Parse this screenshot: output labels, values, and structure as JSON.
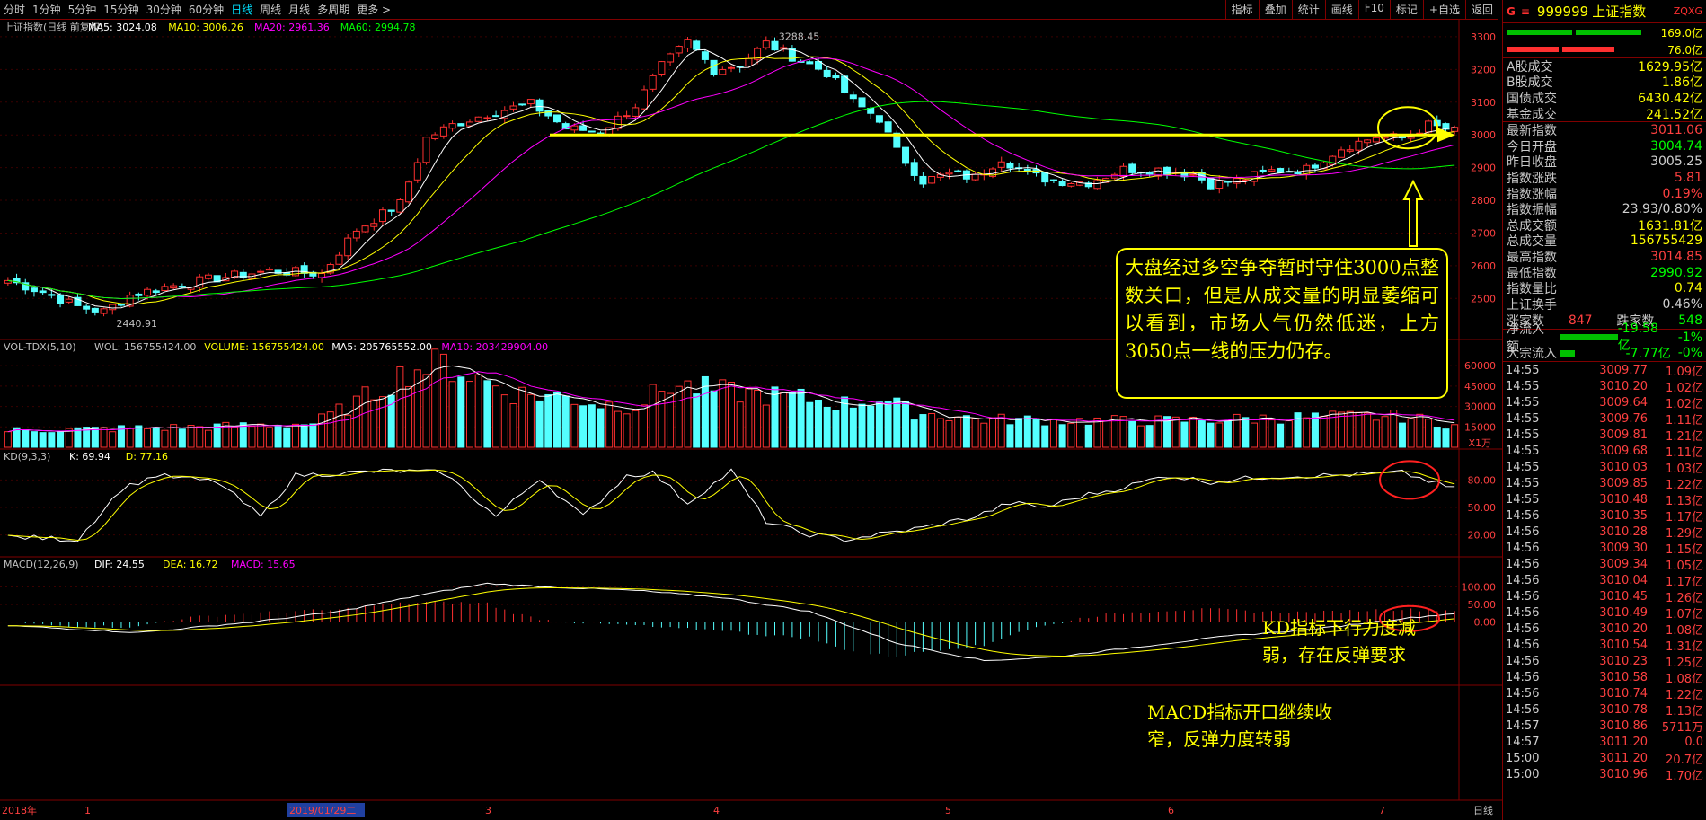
{
  "topbar": {
    "tabs": [
      "分时",
      "1分钟",
      "5分钟",
      "15分钟",
      "30分钟",
      "60分钟",
      "日线",
      "周线",
      "月线",
      "多周期",
      "更多 >"
    ],
    "active": "日线",
    "tools": [
      "指标",
      "叠加",
      "统计",
      "画线",
      "F10",
      "标记",
      "+自选",
      "返回"
    ]
  },
  "panels": {
    "price": {
      "title": "上证指数(日线 前复权)",
      "ma": [
        {
          "label": "MA5: 3024.08",
          "color": "#ffffff"
        },
        {
          "label": "MA10: 3006.26",
          "color": "#ffff00"
        },
        {
          "label": "MA20: 2961.36",
          "color": "#ff00ff"
        },
        {
          "label": "MA60: 2994.78",
          "color": "#00ff00"
        }
      ],
      "high_label": "3288.45",
      "low_label": "2440.91"
    },
    "volume": {
      "title": "VOL-TDX(5,10)",
      "items": [
        {
          "label": "WOL: 156755424.00",
          "color": "#c0c0c0"
        },
        {
          "label": "VOLUME: 156755424.00",
          "color": "#ffff00"
        },
        {
          "label": "MA5: 205765552.00",
          "color": "#ffffff"
        },
        {
          "label": "MA10: 203429904.00",
          "color": "#ff00ff"
        }
      ],
      "unit": "X1万"
    },
    "kd": {
      "title": "KD(9,3,3)",
      "items": [
        {
          "label": "K: 69.94",
          "color": "#ffffff"
        },
        {
          "label": "D: 77.16",
          "color": "#ffff00"
        }
      ]
    },
    "macd": {
      "title": "MACD(12,26,9)",
      "items": [
        {
          "label": "DIF: 24.55",
          "color": "#ffffff"
        },
        {
          "label": "DEA: 16.72",
          "color": "#ffff00"
        },
        {
          "label": "MACD: 15.65",
          "color": "#ff00ff"
        }
      ]
    }
  },
  "annotations": {
    "main": "大盘经过多空争夺暂时守住3000点整数关口，但是从成交量的明显萎缩可以看到，市场人气仍然低迷，上方3050点一线的压力仍存。",
    "kd": "KD指标下行力度减弱，存在反弹要求",
    "macd": "MACD指标开口继续收窄，反弹力度转弱"
  },
  "xaxis": {
    "labels": [
      "2018年",
      "1",
      "2019/01/29二",
      "3",
      "4",
      "5",
      "6",
      "7"
    ],
    "right": "日线"
  },
  "sidebar": {
    "code": "999999",
    "name": "上证指数",
    "tag": "ZQXG",
    "bar_vals": [
      "169.0亿",
      "76.0亿"
    ],
    "trade": [
      [
        "A股成交",
        "1629.95亿"
      ],
      [
        "B股成交",
        "1.86亿"
      ],
      [
        "国债成交",
        "6430.42亿"
      ],
      [
        "基金成交",
        "241.52亿"
      ]
    ],
    "quote": [
      [
        "最新指数",
        "3011.06",
        "#ff4040"
      ],
      [
        "今日开盘",
        "3004.74",
        "#00ff00"
      ],
      [
        "昨日收盘",
        "3005.25",
        "#d0d0d0"
      ],
      [
        "指数涨跌",
        "5.81",
        "#ff4040"
      ],
      [
        "指数涨幅",
        "0.19%",
        "#ff4040"
      ],
      [
        "指数振幅",
        "23.93/0.80%",
        "#d0d0d0"
      ],
      [
        "总成交额",
        "1631.81亿",
        "#ffff00"
      ],
      [
        "总成交量",
        "156755429",
        "#ffff00"
      ],
      [
        "最高指数",
        "3014.85",
        "#ff4040"
      ],
      [
        "最低指数",
        "2990.92",
        "#00ff00"
      ],
      [
        "指数量比",
        "0.74",
        "#ffff00"
      ],
      [
        "上证换手",
        "0.46%",
        "#d0d0d0"
      ]
    ],
    "updown": {
      "up_label": "涨家数",
      "up": "847",
      "down_label": "跌家数",
      "down": "548"
    },
    "flows": [
      [
        "净流入额",
        "-19.58亿",
        "-1%"
      ],
      [
        "大宗流入",
        "-7.77亿",
        "-0%"
      ]
    ],
    "ticks": [
      [
        "14:55",
        "3009.77",
        "1.09亿"
      ],
      [
        "14:55",
        "3010.20",
        "1.02亿"
      ],
      [
        "14:55",
        "3009.64",
        "1.02亿"
      ],
      [
        "14:55",
        "3009.76",
        "1.11亿"
      ],
      [
        "14:55",
        "3009.81",
        "1.21亿"
      ],
      [
        "14:55",
        "3009.68",
        "1.11亿"
      ],
      [
        "14:55",
        "3010.03",
        "1.03亿"
      ],
      [
        "14:55",
        "3009.85",
        "1.22亿"
      ],
      [
        "14:55",
        "3010.48",
        "1.13亿"
      ],
      [
        "14:56",
        "3010.35",
        "1.17亿"
      ],
      [
        "14:56",
        "3010.28",
        "1.29亿"
      ],
      [
        "14:56",
        "3009.30",
        "1.15亿"
      ],
      [
        "14:56",
        "3009.34",
        "1.05亿"
      ],
      [
        "14:56",
        "3010.04",
        "1.17亿"
      ],
      [
        "14:56",
        "3010.45",
        "1.26亿"
      ],
      [
        "14:56",
        "3010.49",
        "1.07亿"
      ],
      [
        "14:56",
        "3010.20",
        "1.08亿"
      ],
      [
        "14:56",
        "3010.54",
        "1.31亿"
      ],
      [
        "14:56",
        "3010.23",
        "1.25亿"
      ],
      [
        "14:56",
        "3010.58",
        "1.08亿"
      ],
      [
        "14:56",
        "3010.74",
        "1.22亿"
      ],
      [
        "14:56",
        "3010.78",
        "1.13亿"
      ],
      [
        "14:57",
        "3010.86",
        "5711万"
      ],
      [
        "14:57",
        "3011.20",
        "0.0"
      ],
      [
        "15:00",
        "3011.20",
        "20.7亿"
      ],
      [
        "15:00",
        "3010.96",
        "1.70亿"
      ]
    ]
  },
  "chart_data": [
    {
      "type": "candlestick",
      "name": "上证指数",
      "ylim": [
        2380,
        3330
      ],
      "yticks": [
        2500,
        2600,
        2700,
        2800,
        2900,
        3000,
        3100,
        3200,
        3300
      ],
      "trend_line": 3000,
      "waypoints": [
        [
          0,
          2555
        ],
        [
          4,
          2520
        ],
        [
          8,
          2475
        ],
        [
          11,
          2460
        ],
        [
          14,
          2510
        ],
        [
          18,
          2535
        ],
        [
          24,
          2562
        ],
        [
          30,
          2585
        ],
        [
          36,
          2575
        ],
        [
          40,
          2710
        ],
        [
          45,
          2790
        ],
        [
          48,
          2990
        ],
        [
          51,
          3030
        ],
        [
          55,
          3065
        ],
        [
          60,
          3095
        ],
        [
          62,
          3060
        ],
        [
          64,
          3020
        ],
        [
          68,
          3010
        ],
        [
          72,
          3090
        ],
        [
          75,
          3210
        ],
        [
          78,
          3285
        ],
        [
          81,
          3200
        ],
        [
          84,
          3215
        ],
        [
          87,
          3280
        ],
        [
          90,
          3240
        ],
        [
          94,
          3190
        ],
        [
          97,
          3100
        ],
        [
          100,
          3050
        ],
        [
          102,
          2950
        ],
        [
          105,
          2860
        ],
        [
          108,
          2880
        ],
        [
          111,
          2870
        ],
        [
          114,
          2930
        ],
        [
          117,
          2880
        ],
        [
          120,
          2860
        ],
        [
          124,
          2855
        ],
        [
          128,
          2895
        ],
        [
          132,
          2895
        ],
        [
          136,
          2880
        ],
        [
          138,
          2850
        ],
        [
          141,
          2860
        ],
        [
          145,
          2890
        ],
        [
          149,
          2895
        ],
        [
          153,
          2960
        ],
        [
          157,
          2995
        ],
        [
          160,
          2990
        ],
        [
          163,
          3030
        ],
        [
          166,
          3011
        ]
      ]
    },
    {
      "type": "bar",
      "name": "VOLUME",
      "unit": "X1万",
      "ylim": [
        0,
        70000
      ],
      "yticks": [
        15000,
        30000,
        45000,
        60000
      ],
      "waypoints": [
        [
          0,
          12000
        ],
        [
          10,
          13000
        ],
        [
          25,
          15000
        ],
        [
          35,
          17000
        ],
        [
          40,
          32000
        ],
        [
          46,
          55000
        ],
        [
          50,
          60000
        ],
        [
          58,
          39000
        ],
        [
          64,
          36000
        ],
        [
          68,
          31000
        ],
        [
          72,
          30000
        ],
        [
          76,
          45000
        ],
        [
          82,
          40000
        ],
        [
          90,
          36000
        ],
        [
          96,
          31000
        ],
        [
          100,
          35000
        ],
        [
          104,
          25000
        ],
        [
          112,
          20000
        ],
        [
          125,
          19000
        ],
        [
          135,
          19000
        ],
        [
          145,
          21000
        ],
        [
          155,
          22000
        ],
        [
          160,
          22000
        ],
        [
          166,
          15700
        ]
      ]
    },
    {
      "type": "line",
      "name": "KD",
      "ylim": [
        0,
        100
      ],
      "yticks": [
        20,
        50,
        80
      ],
      "waypoints": [
        [
          0,
          18
        ],
        [
          8,
          15
        ],
        [
          13,
          70
        ],
        [
          17,
          85
        ],
        [
          24,
          78
        ],
        [
          29,
          40
        ],
        [
          33,
          85
        ],
        [
          44,
          90
        ],
        [
          50,
          88
        ],
        [
          56,
          40
        ],
        [
          61,
          82
        ],
        [
          66,
          40
        ],
        [
          71,
          85
        ],
        [
          74,
          88
        ],
        [
          78,
          55
        ],
        [
          83,
          90
        ],
        [
          87,
          35
        ],
        [
          91,
          22
        ],
        [
          96,
          15
        ],
        [
          101,
          22
        ],
        [
          105,
          28
        ],
        [
          111,
          40
        ],
        [
          115,
          55
        ],
        [
          119,
          50
        ],
        [
          123,
          62
        ],
        [
          128,
          72
        ],
        [
          133,
          85
        ],
        [
          138,
          78
        ],
        [
          145,
          84
        ],
        [
          152,
          85
        ],
        [
          160,
          88
        ],
        [
          166,
          70
        ]
      ]
    },
    {
      "type": "line",
      "name": "MACD",
      "ylim": [
        -170,
        150
      ],
      "yticks": [
        0,
        50,
        100
      ],
      "waypoints": [
        [
          0,
          -10
        ],
        [
          15,
          -30
        ],
        [
          28,
          0
        ],
        [
          38,
          30
        ],
        [
          48,
          80
        ],
        [
          55,
          110
        ],
        [
          62,
          100
        ],
        [
          72,
          90
        ],
        [
          82,
          70
        ],
        [
          92,
          30
        ],
        [
          102,
          -60
        ],
        [
          112,
          -110
        ],
        [
          120,
          -100
        ],
        [
          130,
          -70
        ],
        [
          140,
          -40
        ],
        [
          150,
          -20
        ],
        [
          160,
          10
        ],
        [
          166,
          24.55
        ]
      ]
    }
  ]
}
